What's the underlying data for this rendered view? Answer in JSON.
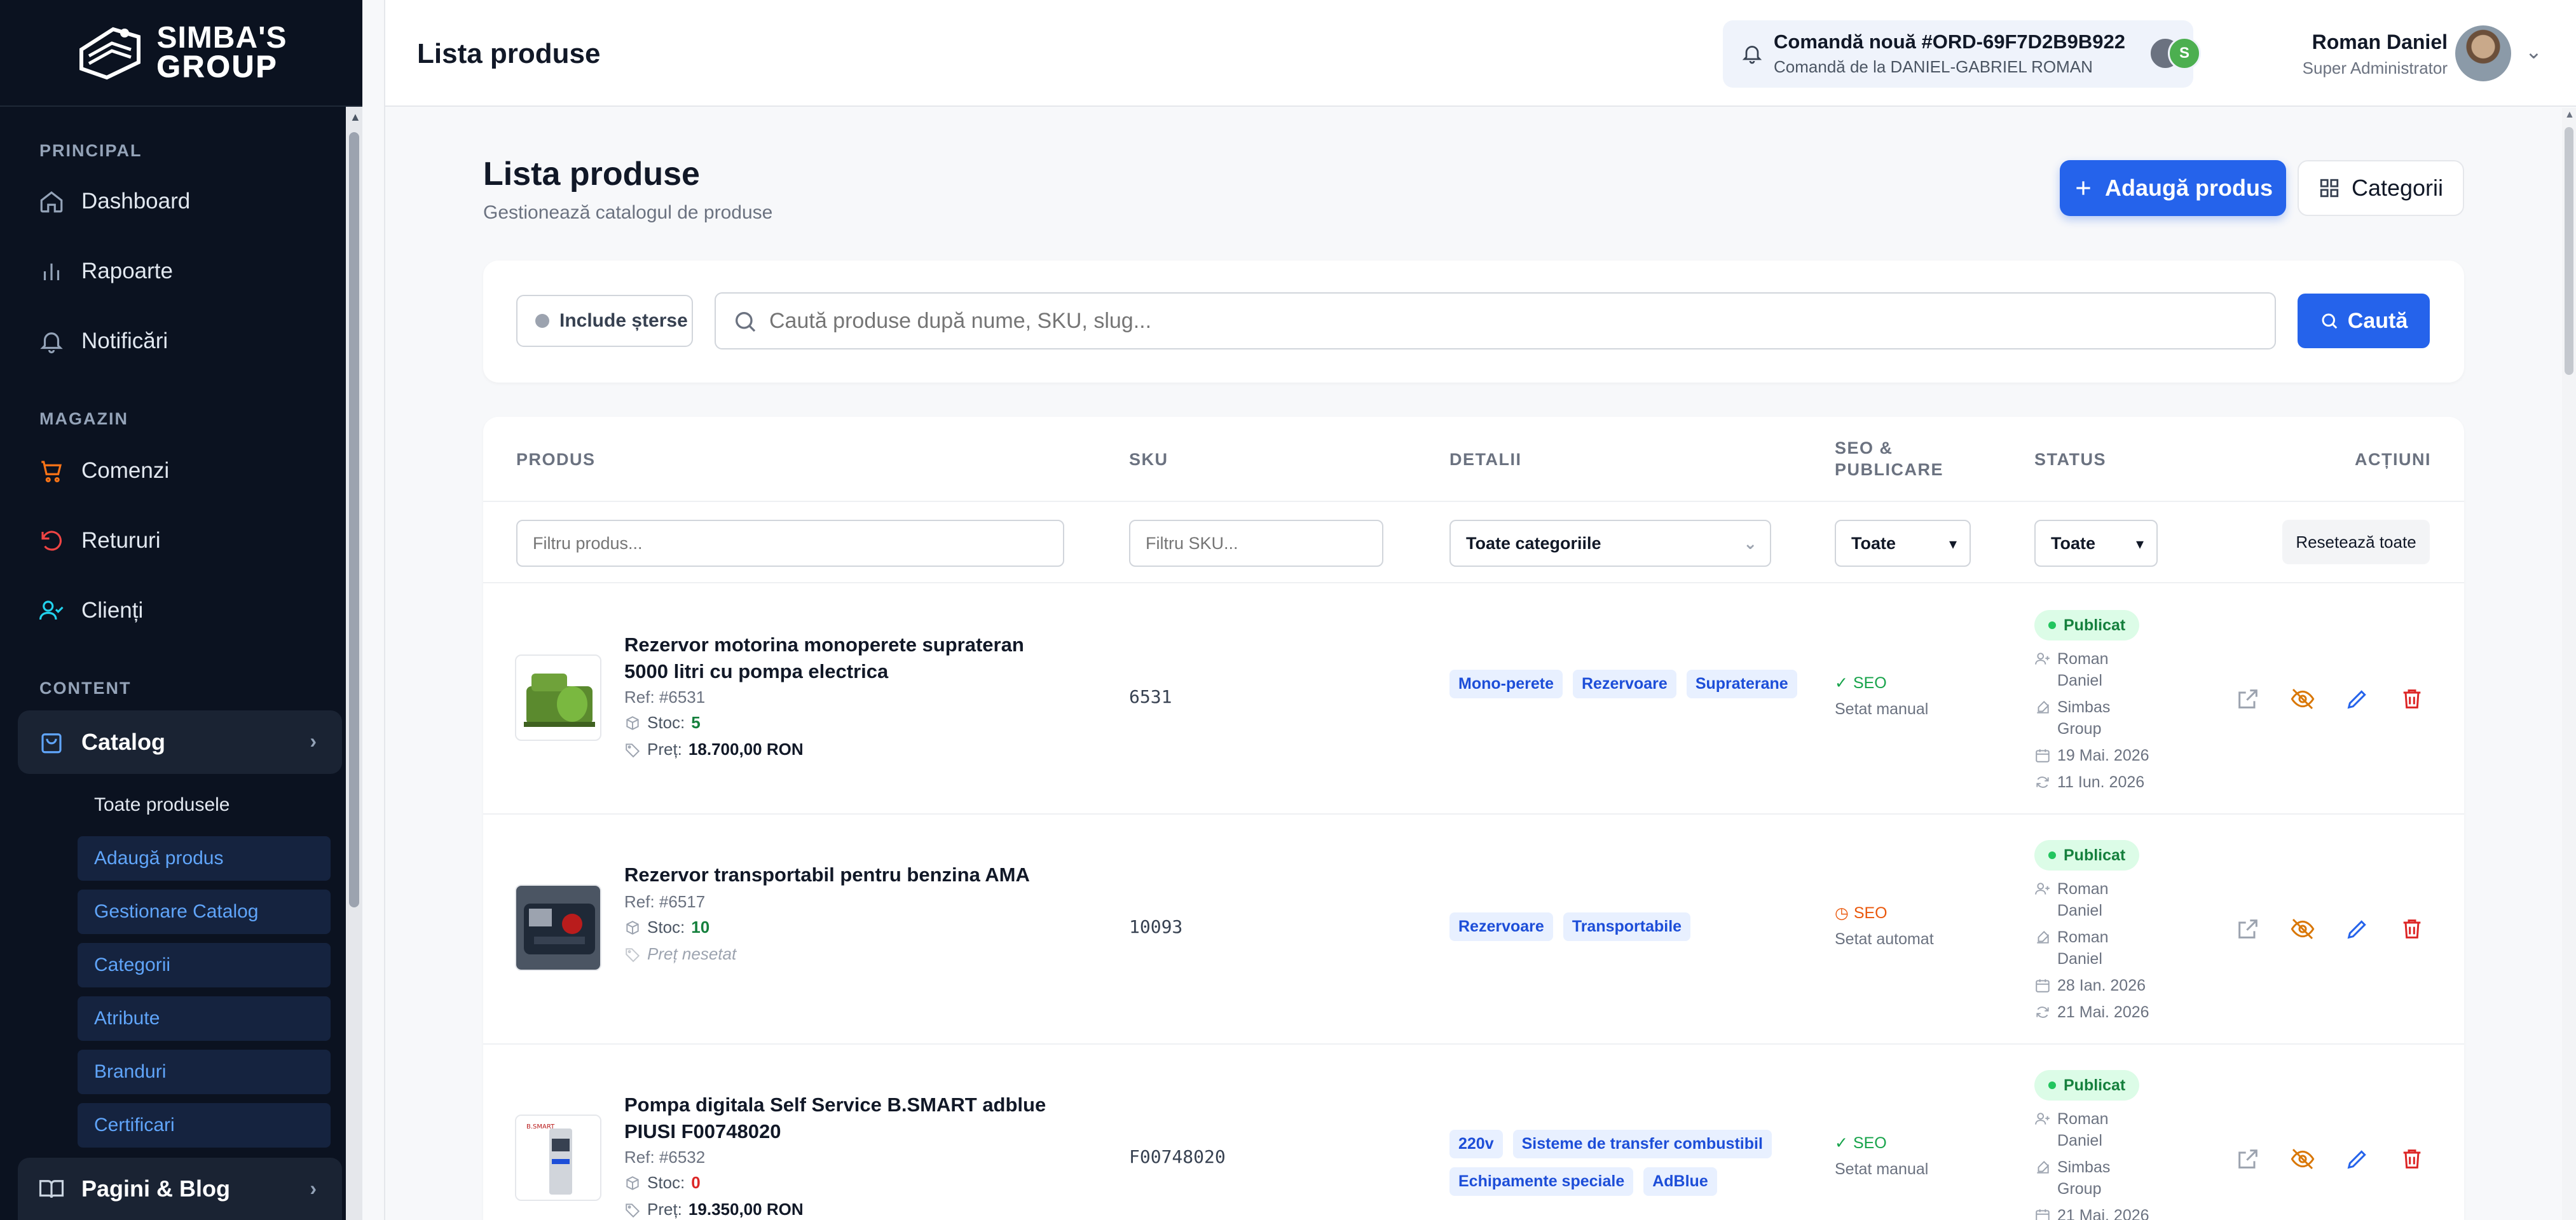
{
  "brand": {
    "line1": "SIMBA'S",
    "line2": "GROUP"
  },
  "sidebar": {
    "sections": {
      "principal": "PRINCIPAL",
      "magazin": "MAGAZIN",
      "content": "CONTENT"
    },
    "items": {
      "dashboard": "Dashboard",
      "rapoarte": "Rapoarte",
      "notificari": "Notificări",
      "comenzi": "Comenzi",
      "retururi": "Retururi",
      "clienti": "Clienți",
      "catalog": "Catalog",
      "pagini": "Pagini & Blog"
    },
    "catalog_sub": [
      "Toate produsele",
      "Adaugă produs",
      "Gestionare Catalog",
      "Categorii",
      "Atribute",
      "Branduri",
      "Certificari"
    ]
  },
  "topbar": {
    "title": "Lista produse",
    "notification": {
      "title": "Comandă nouă #ORD-69F7D2B9B922",
      "subtitle": "Comandă de la DANIEL-GABRIEL ROMAN",
      "avatar_letter": "S"
    },
    "user": {
      "name": "Roman Daniel",
      "role": "Super Administrator"
    }
  },
  "page": {
    "heading": "Lista produse",
    "subheading": "Gestionează catalogul de produse",
    "add_button": "Adaugă produs",
    "categories_button": "Categorii"
  },
  "search": {
    "include_deleted": "Include șterse",
    "placeholder": "Caută produse după nume, SKU, slug...",
    "button": "Caută"
  },
  "table": {
    "headers": {
      "produs": "PRODUS",
      "sku": "SKU",
      "detalii": "DETALII",
      "seo1": "SEO &",
      "seo2": "PUBLICARE",
      "status": "STATUS",
      "actiuni": "ACȚIUNI"
    },
    "filters": {
      "produs_placeholder": "Filtru produs...",
      "sku_placeholder": "Filtru SKU...",
      "categorii": "Toate categoriile",
      "seo": "Toate",
      "status": "Toate",
      "reset": "Resetează toate"
    },
    "rows": [
      {
        "name": "Rezervor motorina monoperete suprateran 5000 litri cu pompa electrica",
        "ref": "Ref: #6531",
        "stoc_label": "Stoc:",
        "stoc": "5",
        "pret_label": "Preț:",
        "pret": "18.700,00 RON",
        "sku": "6531",
        "tags": [
          "Mono-perete",
          "Rezervoare",
          "Supraterane"
        ],
        "seo": "SEO",
        "seo_sub": "Setat manual",
        "status": "Publicat",
        "creator": "Roman Daniel",
        "editor": "Simbas Group",
        "created": "19 Mai. 2026",
        "updated": "11 Iun. 2026"
      },
      {
        "name": "Rezervor transportabil pentru benzina AMA",
        "ref": "Ref: #6517",
        "stoc_label": "Stoc:",
        "stoc": "10",
        "pret_label": "Preț nesetat",
        "pret": "",
        "sku": "10093",
        "tags": [
          "Rezervoare",
          "Transportabile"
        ],
        "seo": "SEO",
        "seo_sub": "Setat automat",
        "status": "Publicat",
        "creator": "Roman Daniel",
        "editor": "Roman Daniel",
        "created": "28 Ian. 2026",
        "updated": "21 Mai. 2026"
      },
      {
        "name": "Pompa digitala Self Service B.SMART adblue PIUSI F00748020",
        "ref": "Ref: #6532",
        "stoc_label": "Stoc:",
        "stoc": "0",
        "pret_label": "Preț:",
        "pret": "19.350,00 RON",
        "sku": "F00748020",
        "tags": [
          "220v",
          "Sisteme de transfer combustibil",
          "Echipamente speciale",
          "AdBlue"
        ],
        "seo": "SEO",
        "seo_sub": "Setat manual",
        "status": "Publicat",
        "creator": "Roman Daniel",
        "editor": "Simbas Group",
        "created": "21 Mai. 2026",
        "updated": ""
      }
    ]
  }
}
